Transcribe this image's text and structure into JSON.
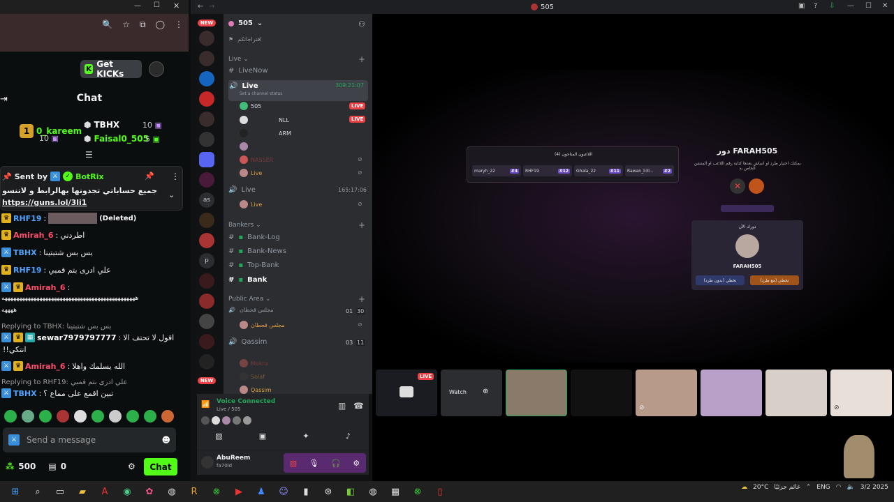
{
  "kick": {
    "get_kicks": "Get KICKs",
    "chat_title": "Chat",
    "leaderboard": {
      "first_rank": "1",
      "first_user": "0_kareem",
      "first_count": "10",
      "second_user": "TBHX",
      "second_count": "10",
      "third_user": "Faisal0_505",
      "third_count": "5"
    },
    "pinned": {
      "sent_by": "Sent by",
      "author": "BotRix",
      "text": "جميع حساباتي تجدونها بهالرابط و لاتنسون الفولو 💙🩵",
      "link": "https://guns.lol/3li1"
    },
    "messages": [
      {
        "user": "RHF19",
        "text": "(Deleted)",
        "color": "blue"
      },
      {
        "user": "Amirah_6",
        "text": "اطردني",
        "color": "red"
      },
      {
        "user": "TBHX",
        "text": "بس بس شتبتينا",
        "color": "blue"
      },
      {
        "user": "RHF19",
        "text": "علي ادرى بتم قمبي",
        "color": "blue"
      },
      {
        "user": "Amirah_6",
        "text": "",
        "color": "red"
      },
      {
        "user": "",
        "text": "ههههههههههههههههههههههههههههههههههههههههههههههه",
        "color": "white"
      },
      {
        "user": "",
        "text": "ههههه",
        "color": "white"
      }
    ],
    "reply1_label": "Replying to TBHX: بس بس شتبتينا",
    "reply1_user": "sewar7979797777",
    "reply1_text": "اقول لا تحتف الا",
    "reply1_text2": "!!انتكي",
    "msg_amirah2_user": "Amirah_6",
    "msg_amirah2_text": "الله يسلمك واهلا",
    "reply2_label": "Replying to RHF19: علي ادرى بتم قمبي",
    "reply2_user": "TBHX",
    "reply2_text": "تبين اقمع على مماع ؟",
    "send_placeholder": "Send a message",
    "points": "500",
    "drops": "0",
    "chat_button": "Chat"
  },
  "discord": {
    "window_title": "505",
    "server_name": "505",
    "server_subtitle": "اقتراحاتكم",
    "new_tag": "NEW",
    "categories": {
      "live": "Live",
      "bankers": "Bankers",
      "public": "Public Area"
    },
    "channels": {
      "livenow": "LiveNow",
      "live": "Live",
      "live_status": "Set a channel status",
      "live_timer": "309:21:07",
      "live2": "Live",
      "live2_timer": "165:17:06",
      "bank_log": "Bank-Log",
      "bank_news": "Bank-News",
      "top_bank": "Top-Bank",
      "bank": "Bank",
      "majlis": "مجلس قحطان",
      "majlis_count_a": "01",
      "majlis_count_b": "30",
      "majlis_user": "مجلس قحطان",
      "qassim": "Qassim",
      "qassim_count_a": "03",
      "qassim_count_b": "11",
      "qassim_users": [
        "Mokra",
        "Solaf",
        "Qassim"
      ]
    },
    "voice_users": [
      {
        "name": "505",
        "live": true
      },
      {
        "name": "NLL",
        "live": true
      },
      {
        "name": "ARM",
        "live": false
      },
      {
        "name": "NASSER",
        "live": false
      },
      {
        "name": "Live",
        "live": false
      }
    ],
    "live2_user": "Live",
    "live_badge": "LIVE",
    "voice_connected": "Voice Connected",
    "voice_channel": "Live / 505",
    "username": "AbuReem",
    "user_tag": "fa70ld",
    "as_label": "as",
    "p_label": "p",
    "game": {
      "players_title": "اللاعبون المتاحون (4)",
      "players": [
        {
          "name": "maryh_22",
          "num": "#4"
        },
        {
          "name": "RHF19",
          "num": "#12"
        },
        {
          "name": "Ghala_22",
          "num": "#11"
        },
        {
          "name": "Rawan_li3l...",
          "num": "#2"
        }
      ],
      "turn_title": "دور FARAH505",
      "turn_desc": "يمكنك اختيار طرد او انماش بعدها كتابة رقم اللاعب او المنشن الخاص به",
      "your_turn": "دورك الآن",
      "player_name": "FARAH505",
      "btn_skip": "تخطي (بدون طرد)",
      "btn_kick": "تخطي (مع طرد)"
    },
    "watch_label": "Watch"
  },
  "taskbar": {
    "weather": "20°C",
    "weather_text": "غائم جزئيًا",
    "lang": "ENG",
    "date": "3/2 2025"
  },
  "colors": {
    "kick_green": "#53fc18",
    "discord_live": "#ed4245",
    "discord_green": "#23a55a",
    "discord_blurple": "#5865f2"
  }
}
